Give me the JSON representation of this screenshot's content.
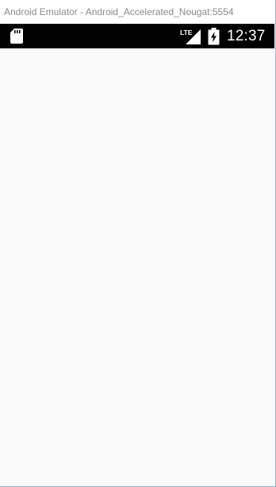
{
  "window": {
    "title": "Android Emulator - Android_Accelerated_Nougat:5554"
  },
  "status_bar": {
    "time": "12:37",
    "network_label": "LTE",
    "icons": [
      "sd-card-icon",
      "lte-signal-icon",
      "battery-charging-icon"
    ]
  },
  "colors": {
    "status_bar": "#000000",
    "content_background": "#fafafa",
    "title_text": "#8a8a8a",
    "window_border": "#8fb3c9"
  }
}
